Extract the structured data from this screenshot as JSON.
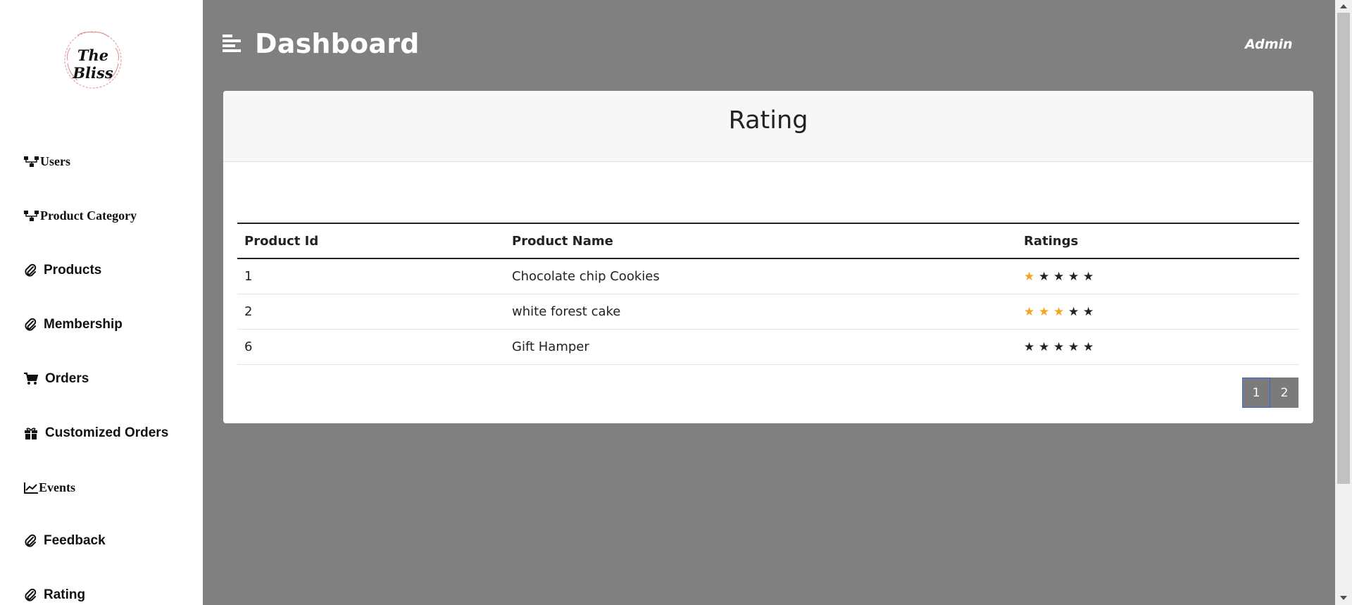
{
  "brand": {
    "logo_text": "The Bliss"
  },
  "sidebar": {
    "items": [
      {
        "label": "Users",
        "icon": "sitemap-icon"
      },
      {
        "label": "Product Category",
        "icon": "sitemap-icon"
      },
      {
        "label": "Products",
        "icon": "paperclip-icon"
      },
      {
        "label": "Membership",
        "icon": "paperclip-icon"
      },
      {
        "label": "Orders",
        "icon": "cart-icon"
      },
      {
        "label": "Customized Orders",
        "icon": "gift-icon"
      },
      {
        "label": "Events",
        "icon": "line-chart-icon"
      },
      {
        "label": "Feedback",
        "icon": "paperclip-icon"
      },
      {
        "label": "Rating",
        "icon": "paperclip-icon"
      }
    ]
  },
  "header": {
    "title": "Dashboard",
    "user": "Admin"
  },
  "card": {
    "title": "Rating",
    "columns": [
      "Product Id",
      "Product Name",
      "Ratings"
    ],
    "rows": [
      {
        "id": "1",
        "name": "Chocolate chip Cookies",
        "rating": 1,
        "max": 5
      },
      {
        "id": "2",
        "name": "white forest cake",
        "rating": 3,
        "max": 5
      },
      {
        "id": "6",
        "name": "Gift Hamper",
        "rating": 0,
        "max": 5
      }
    ],
    "pagination": {
      "pages": [
        "1",
        "2"
      ],
      "current": "1"
    }
  },
  "colors": {
    "accent_star": "#f2a51e",
    "background": "#808080",
    "pager": "#7b7b7b"
  }
}
